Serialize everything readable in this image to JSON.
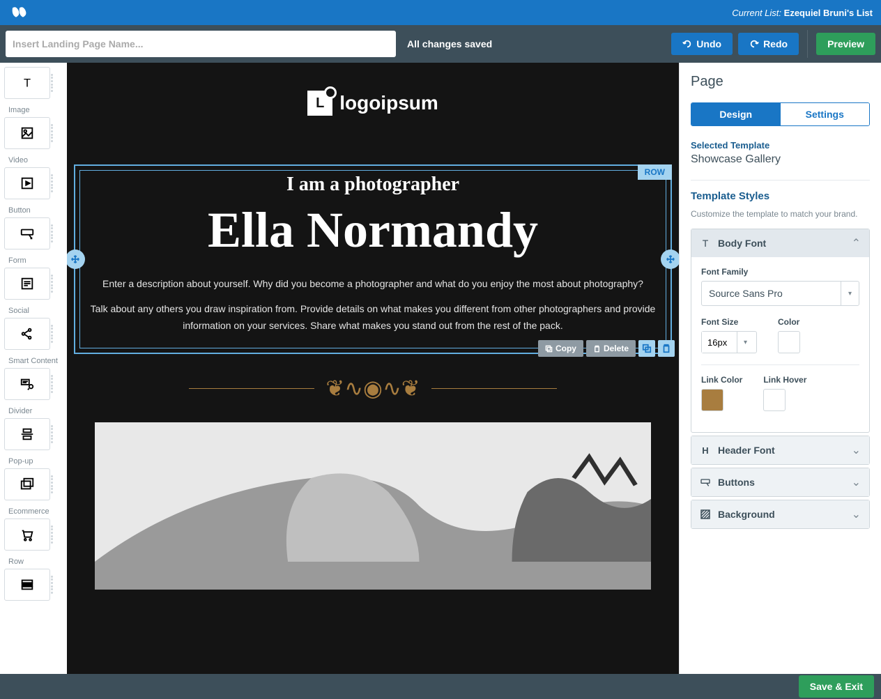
{
  "header": {
    "current_list_label": "Current List:",
    "current_list_value": "Ezequiel Bruni's List"
  },
  "toolbar": {
    "page_name_placeholder": "Insert Landing Page Name...",
    "save_status": "All changes saved",
    "undo_label": "Undo",
    "redo_label": "Redo",
    "preview_label": "Preview"
  },
  "left_sidebar": {
    "items": [
      {
        "label": "",
        "icon": "text"
      },
      {
        "label": "Image",
        "icon": "image"
      },
      {
        "label": "Video",
        "icon": "video"
      },
      {
        "label": "Button",
        "icon": "button"
      },
      {
        "label": "Form",
        "icon": "form"
      },
      {
        "label": "Social",
        "icon": "social"
      },
      {
        "label": "Smart Content",
        "icon": "smart-content"
      },
      {
        "label": "Divider",
        "icon": "divider"
      },
      {
        "label": "Pop-up",
        "icon": "popup"
      },
      {
        "label": "Ecommerce",
        "icon": "ecommerce"
      },
      {
        "label": "Row",
        "icon": "row"
      }
    ]
  },
  "canvas": {
    "logo_text": "logoipsum",
    "row_badge": "ROW",
    "subhead": "I am a photographer",
    "hero_title": "Ella Normandy",
    "desc1": "Enter a description about yourself. Why did you become a photographer and what do you enjoy the most about photography?",
    "desc2": "Talk about any others you draw inspiration from. Provide details on what makes you different from other photographers and provide information on your services. Share what makes you stand out from the rest of the pack.",
    "copy_label": "Copy",
    "delete_label": "Delete"
  },
  "right_panel": {
    "title": "Page",
    "tabs": {
      "design": "Design",
      "settings": "Settings"
    },
    "template_label": "Selected Template",
    "template_value": "Showcase Gallery",
    "styles_heading": "Template Styles",
    "styles_sub": "Customize the template to match your brand.",
    "accordions": {
      "body_font": "Body Font",
      "header_font": "Header Font",
      "buttons": "Buttons",
      "background": "Background"
    },
    "body_font": {
      "font_family_label": "Font Family",
      "font_family_value": "Source Sans Pro",
      "font_size_label": "Font Size",
      "font_size_value": "16px",
      "color_label": "Color",
      "color_value": "#ffffff",
      "link_color_label": "Link Color",
      "link_color_value": "#a87d3f",
      "link_hover_label": "Link Hover",
      "link_hover_value": "#ffffff"
    }
  },
  "footer": {
    "save_exit": "Save & Exit"
  }
}
